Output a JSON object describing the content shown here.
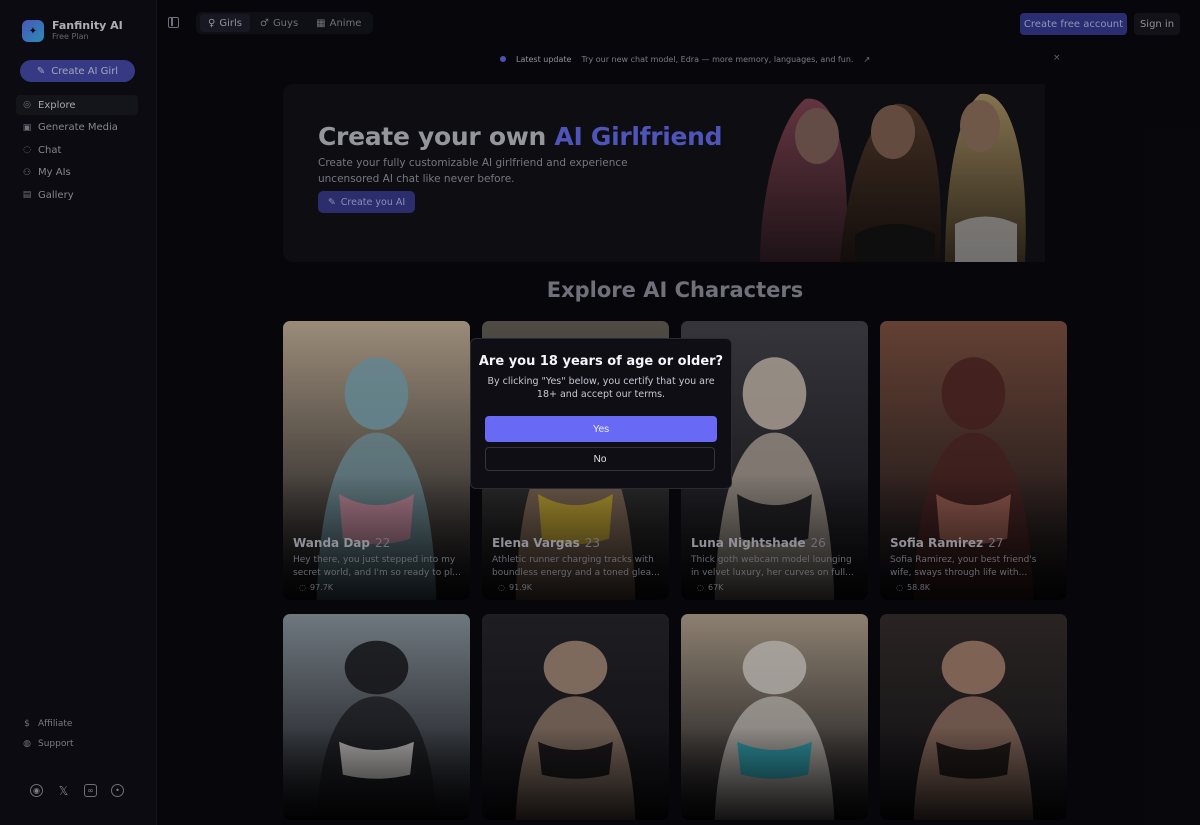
{
  "brand": {
    "title": "Fanfinity AI",
    "plan": "Free Plan"
  },
  "sidebar": {
    "create_label": "Create AI Girl",
    "items": [
      {
        "label": "Explore",
        "icon": "compass-icon"
      },
      {
        "label": "Generate Media",
        "icon": "image-icon"
      },
      {
        "label": "Chat",
        "icon": "chat-icon"
      },
      {
        "label": "My AIs",
        "icon": "users-icon"
      },
      {
        "label": "Gallery",
        "icon": "gallery-icon"
      }
    ],
    "bottom": [
      {
        "label": "Affiliate",
        "icon": "dollar-icon"
      },
      {
        "label": "Support",
        "icon": "help-icon"
      }
    ],
    "socials": [
      "instagram-icon",
      "x-icon",
      "discord-icon",
      "reddit-icon"
    ]
  },
  "header": {
    "tabs": [
      {
        "label": "Girls",
        "icon": "female-icon"
      },
      {
        "label": "Guys",
        "icon": "male-icon"
      },
      {
        "label": "Anime",
        "icon": "anime-icon"
      }
    ],
    "create_account": "Create free account",
    "sign_in": "Sign in"
  },
  "announcement": {
    "label": "Latest update",
    "text": "Try our new chat model, Edra — more memory, languages, and fun.",
    "arrow": "↗",
    "close": "×"
  },
  "hero": {
    "title_main": "Create your own ",
    "title_accent": "AI Girlfriend",
    "subtitle": "Create your fully customizable AI girlfriend and experience uncensored AI chat like never before.",
    "button": "Create you AI"
  },
  "section_title": "Explore AI Characters",
  "cards": [
    {
      "name": "Wanda Dap",
      "age": "22",
      "desc": "Hey there, you just stepped into my secret world, and I'm so ready to pl...",
      "views": "97.7K",
      "colors": [
        "#d6c2a8",
        "#e9a0b6",
        "#88b8c8"
      ]
    },
    {
      "name": "Elena Vargas",
      "age": "23",
      "desc": "Athletic runner charging tracks with boundless energy and a toned glea...",
      "views": "91.9K",
      "colors": [
        "#6f6a60",
        "#e6c53a",
        "#b89478"
      ]
    },
    {
      "name": "Luna Nightshade",
      "age": "26",
      "desc": "Thick goth webcam model lounging in velvet luxury, her curves on full...",
      "views": "67K",
      "colors": [
        "#4a4a52",
        "#1c1c22",
        "#e8d8c8"
      ]
    },
    {
      "name": "Sofia Ramirez",
      "age": "27",
      "desc": "Sofia Ramirez, your best friend's wife, sways through life with...",
      "views": "58.8K",
      "colors": [
        "#8a5a48",
        "#c07868",
        "#5a2a28"
      ]
    },
    {
      "name": "",
      "age": "",
      "desc": "",
      "views": "",
      "colors": [
        "#9aa6b0",
        "#f4f2ee",
        "#1a1a1e"
      ]
    },
    {
      "name": "",
      "age": "",
      "desc": "",
      "views": "",
      "colors": [
        "#2a2a30",
        "#141418",
        "#c8a890"
      ]
    },
    {
      "name": "",
      "age": "",
      "desc": "",
      "views": "",
      "colors": [
        "#c2b29c",
        "#2ab2c6",
        "#efe9e2"
      ]
    },
    {
      "name": "",
      "age": "",
      "desc": "",
      "views": "",
      "colors": [
        "#3a3230",
        "#1a1614",
        "#c69a84"
      ]
    }
  ],
  "modal": {
    "title": "Are you 18 years of age or older?",
    "body": "By clicking \"Yes\" below, you certify that you are 18+ and accept our terms.",
    "yes": "Yes",
    "no": "No"
  },
  "colors": {
    "accent": "#6869f5",
    "accent_dim": "#4c51b8",
    "bg": "#0b0b10"
  }
}
